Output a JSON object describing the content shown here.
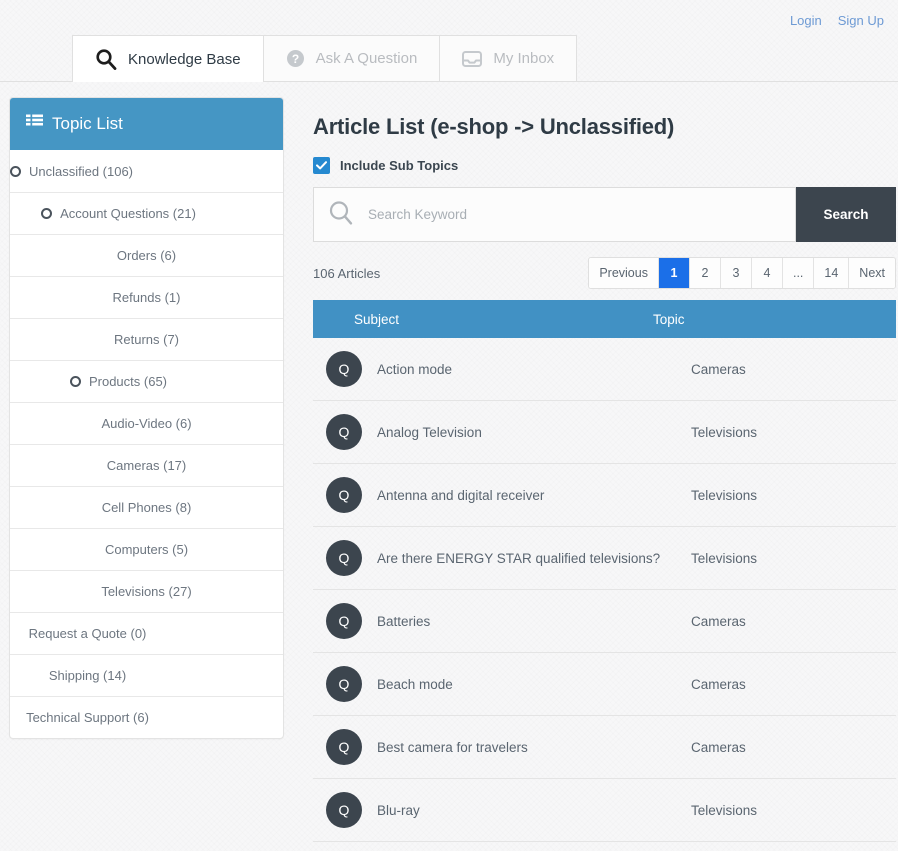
{
  "auth": {
    "login_label": "Login",
    "signup_label": "Sign Up"
  },
  "tabs": [
    {
      "label": "Knowledge Base",
      "icon": "search-icon",
      "active": true
    },
    {
      "label": "Ask A Question",
      "icon": "question-circle-icon",
      "active": false
    },
    {
      "label": "My Inbox",
      "icon": "inbox-icon",
      "active": false
    }
  ],
  "sidebar": {
    "header_title": "Topic List",
    "header_icon": "list-icon",
    "header_color": "#4596c4",
    "items": [
      {
        "label": "Unclassified (106)",
        "level": 0,
        "has_ring": true
      },
      {
        "label": "Account Questions (21)",
        "level": 1,
        "has_ring": true
      },
      {
        "label": "Orders (6)",
        "level": 2,
        "has_ring": false
      },
      {
        "label": "Refunds (1)",
        "level": 2,
        "has_ring": false
      },
      {
        "label": "Returns (7)",
        "level": 2,
        "has_ring": false
      },
      {
        "label": "Products (65)",
        "level": 1,
        "has_ring": true
      },
      {
        "label": "Audio-Video (6)",
        "level": 2,
        "has_ring": false
      },
      {
        "label": "Cameras (17)",
        "level": 2,
        "has_ring": false
      },
      {
        "label": "Cell Phones (8)",
        "level": 2,
        "has_ring": false
      },
      {
        "label": "Computers (5)",
        "level": 2,
        "has_ring": false
      },
      {
        "label": "Televisions (27)",
        "level": 2,
        "has_ring": false
      },
      {
        "label": "Request a Quote (0)",
        "level": 1.5,
        "has_ring": false
      },
      {
        "label": "Shipping (14)",
        "level": 1.5,
        "has_ring": false
      },
      {
        "label": "Technical Support (6)",
        "level": 1.5,
        "has_ring": false
      }
    ]
  },
  "main": {
    "title": "Article List (e-shop -> Unclassified)",
    "include_sub_topics": {
      "label": "Include Sub Topics",
      "checked": true,
      "color": "#2589d0"
    },
    "search": {
      "placeholder": "Search Keyword",
      "value": "",
      "button_label": "Search",
      "icon": "search-icon",
      "button_color": "#3c454e"
    },
    "article_count": "106 Articles",
    "pagination": {
      "active_color": "#1b6fe8",
      "buttons": [
        {
          "label": "Previous",
          "active": false
        },
        {
          "label": "1",
          "active": true
        },
        {
          "label": "2",
          "active": false
        },
        {
          "label": "3",
          "active": false
        },
        {
          "label": "4",
          "active": false
        },
        {
          "label": "...",
          "active": false
        },
        {
          "label": "14",
          "active": false
        },
        {
          "label": "Next",
          "active": false
        }
      ]
    },
    "table": {
      "header_color": "#4191c4",
      "columns": {
        "subject": "Subject",
        "topic": "Topic"
      },
      "badge_label": "Q",
      "rows": [
        {
          "subject": "Action mode",
          "topic": "Cameras"
        },
        {
          "subject": "Analog Television",
          "topic": "Televisions"
        },
        {
          "subject": "Antenna and digital receiver",
          "topic": "Televisions"
        },
        {
          "subject": "Are there ENERGY STAR qualified televisions?",
          "topic": "Televisions"
        },
        {
          "subject": "Batteries",
          "topic": "Cameras"
        },
        {
          "subject": "Beach mode",
          "topic": "Cameras"
        },
        {
          "subject": "Best camera for travelers",
          "topic": "Cameras"
        },
        {
          "subject": "Blu-ray",
          "topic": "Televisions"
        }
      ]
    }
  }
}
